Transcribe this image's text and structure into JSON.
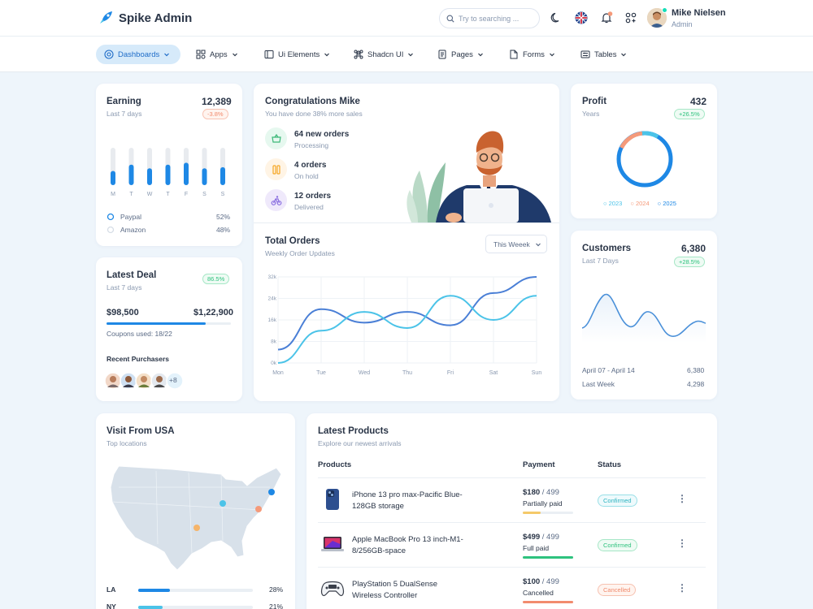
{
  "header": {
    "brand": "Spike Admin",
    "search_placeholder": "Try to searching ...",
    "user": {
      "name": "Mike Nielsen",
      "role": "Admin"
    },
    "icons": [
      "rocket-icon",
      "search-icon",
      "moon-icon",
      "uk-flag-icon",
      "bell-icon",
      "apps-icon"
    ]
  },
  "nav": {
    "items": [
      {
        "label": "Dashboards",
        "icon": "grid-icon",
        "active": true
      },
      {
        "label": "Apps",
        "icon": "apps-icon"
      },
      {
        "label": "Ui Elements",
        "icon": "layers-icon"
      },
      {
        "label": "Shadcn UI",
        "icon": "command-icon"
      },
      {
        "label": "Pages",
        "icon": "page-icon"
      },
      {
        "label": "Forms",
        "icon": "form-icon"
      },
      {
        "label": "Tables",
        "icon": "table-icon"
      }
    ]
  },
  "earning": {
    "title": "Earning",
    "subtitle": "Last 7 days",
    "value": "12,389",
    "badge": "-3.8%",
    "days": [
      "M",
      "T",
      "W",
      "T",
      "F",
      "S",
      "S"
    ],
    "bars": [
      0.38,
      0.55,
      0.45,
      0.55,
      0.6,
      0.45,
      0.48
    ],
    "legend": [
      {
        "label": "Paypal",
        "value": "52%"
      },
      {
        "label": "Amazon",
        "value": "48%"
      }
    ]
  },
  "deal": {
    "title": "Latest Deal",
    "subtitle": "Last 7 days",
    "badge": "86.5%",
    "current": "$98,500",
    "target": "$1,22,900",
    "progress": 0.8,
    "coupons": "Coupons used: 18/22",
    "recent": "Recent Purchasers",
    "more": "+8"
  },
  "congrats": {
    "title": "Congratulations Mike",
    "subtitle": "You have done 38% more sales",
    "items": [
      {
        "title": "64 new orders",
        "status": "Processing",
        "icon": "basket-icon",
        "color": "#e6f8ef",
        "fg": "#3cb878"
      },
      {
        "title": "4 orders",
        "status": "On hold",
        "icon": "pause-icon",
        "color": "#fff4e5",
        "fg": "#f5a623"
      },
      {
        "title": "12 orders",
        "status": "Delivered",
        "icon": "bike-icon",
        "color": "#efe9fb",
        "fg": "#8a6fe0"
      }
    ]
  },
  "orders": {
    "title": "Total Orders",
    "subtitle": "Weekly Order Updates",
    "select": "This Weeek"
  },
  "chart_data": {
    "type": "line",
    "title": "Total Orders",
    "categories": [
      "Mon",
      "Tue",
      "Wed",
      "Thu",
      "Fri",
      "Sat",
      "Sun"
    ],
    "yticks": [
      "0k",
      "8k",
      "16k",
      "24k",
      "32k"
    ],
    "ylim": [
      0,
      32
    ],
    "series": [
      {
        "color": "#4a7fd6",
        "values": [
          5,
          20,
          15,
          19,
          14,
          26,
          32
        ]
      },
      {
        "color": "#4bc3e8",
        "values": [
          0,
          12,
          19,
          13,
          25,
          16,
          25
        ]
      }
    ]
  },
  "profit": {
    "title": "Profit",
    "subtitle": "Years",
    "value": "432",
    "badge": "+26.5%",
    "legend": [
      "2023",
      "2024",
      "2025"
    ],
    "legend_colors": [
      "#4bc3e8",
      "#f59a7a",
      "#1e88e5"
    ]
  },
  "customers": {
    "title": "Customers",
    "subtitle": "Last 7 Days",
    "value": "6,380",
    "badge": "+28.5%",
    "period": "April 07 - April 14",
    "period_value": "6,380",
    "last_label": "Last Week",
    "last_value": "4,298"
  },
  "visit": {
    "title": "Visit From USA",
    "subtitle": "Top locations",
    "states": [
      {
        "name": "LA",
        "pct": "28%",
        "fill": 0.28,
        "color": "#1e88e5"
      },
      {
        "name": "NY",
        "pct": "21%",
        "fill": 0.21,
        "color": "#4bc3e8"
      }
    ]
  },
  "products": {
    "title": "Latest Products",
    "subtitle": "Explore our newest arrivals",
    "headers": {
      "product": "Products",
      "payment": "Payment",
      "status": "Status"
    },
    "rows": [
      {
        "name": "iPhone 13 pro max-Pacific Blue-128GB storage",
        "price": "$180",
        "total": " / 499",
        "pay": "Partially paid",
        "paid": 0.36,
        "bar_color": "#f5c969",
        "status": "Confirmed",
        "sclass": "s-ok",
        "icon": "phone-icon"
      },
      {
        "name": "Apple MacBook Pro 13 inch-M1-8/256GB-space",
        "price": "$499",
        "total": " / 499",
        "pay": "Full paid",
        "paid": 1,
        "bar_color": "#2ec27e",
        "status": "Confirmed",
        "sclass": "s-full",
        "icon": "laptop-icon"
      },
      {
        "name": "PlayStation 5 DualSense Wireless Controller",
        "price": "$100",
        "total": " / 499",
        "pay": "Cancelled",
        "paid": 1,
        "bar_color": "#f28b6e",
        "status": "Cancelled",
        "sclass": "s-can",
        "icon": "gamepad-icon"
      }
    ]
  }
}
